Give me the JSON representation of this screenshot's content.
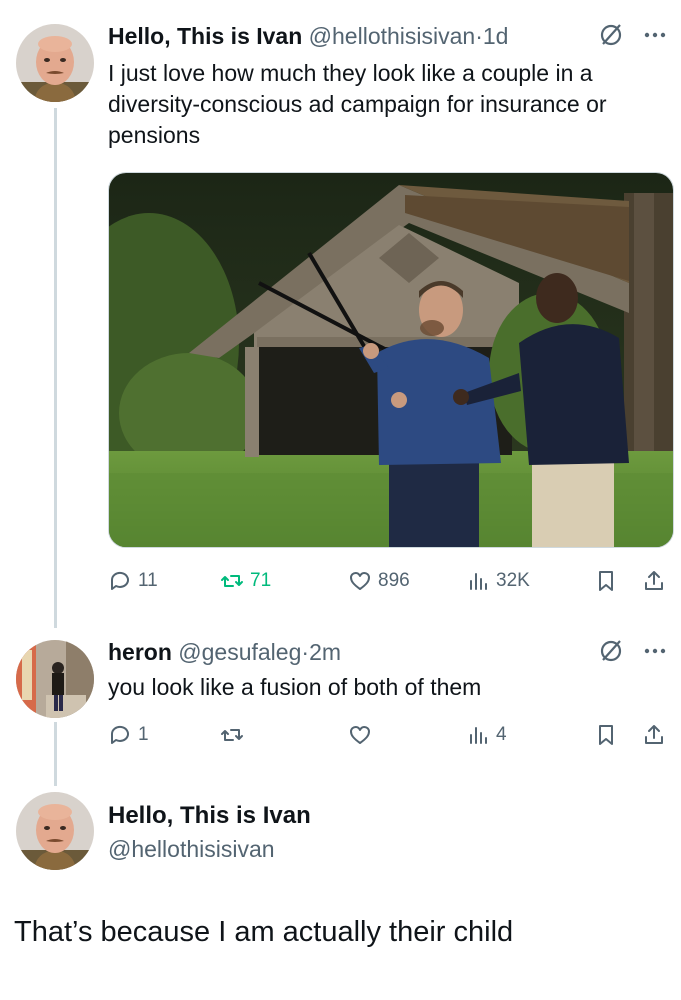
{
  "tweet1": {
    "name": "Hello, This is Ivan",
    "handle": "@hellothisisivan",
    "dot": "·",
    "time": "1d",
    "text": "I just love how much they look like a couple in a diversity-conscious ad campaign for insurance or pensions",
    "media_icon": "photo-two-men-outdoors",
    "stats": {
      "replies": "11",
      "retweets": "71",
      "likes": "896",
      "views": "32K"
    }
  },
  "tweet2": {
    "name": "heron",
    "handle": "@gesufaleg",
    "dot": "·",
    "time": "2m",
    "text": "you look like a fusion of both of them",
    "stats": {
      "replies": "1",
      "retweets": "",
      "likes": "",
      "views": "4"
    }
  },
  "tweet3": {
    "name": "Hello, This is Ivan",
    "handle": "@hellothisisivan",
    "text": "That’s because I am actually their child"
  },
  "icons": [
    "grok-icon",
    "more-icon",
    "reply-icon",
    "retweet-icon",
    "like-icon",
    "views-icon",
    "bookmark-icon",
    "share-icon",
    "avatar"
  ],
  "colors": {
    "retweet_green": "#00ba7c",
    "secondary": "#536471",
    "text": "#0f1419",
    "thread_line": "#cfd9de"
  }
}
